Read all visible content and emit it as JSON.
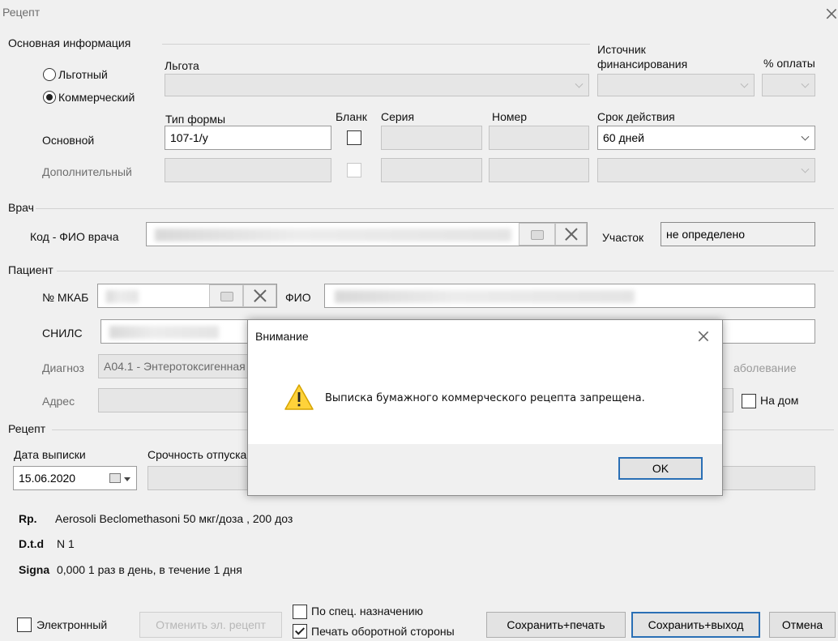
{
  "window": {
    "title": "Рецепт"
  },
  "main_info": {
    "section": "Основная информация",
    "radio_lgot": "Льготный",
    "radio_commercial": "Коммерческий",
    "lgota_label": "Льгота",
    "source_label": "Источник финансирования",
    "pay_label": "% оплаты",
    "form_type_label": "Тип формы",
    "blank_label": "Бланк",
    "series_label": "Серия",
    "number_label": "Номер",
    "validity_label": "Срок действия",
    "main_row_label": "Основной",
    "extra_row_label": "Дополнительный",
    "form_type_value": "107-1/у",
    "validity_value": "60 дней"
  },
  "doctor": {
    "section": "Врач",
    "code_label": "Код - ФИО врача",
    "district_label": "Участок",
    "district_value": "не определено"
  },
  "patient": {
    "section": "Пациент",
    "mkab_label": "№ МКАБ",
    "fio_label": "ФИО",
    "snils_label": "СНИЛС",
    "diagnosis_label": "Диагноз",
    "diagnosis_value": "А04.1 - Энтеротоксигенная",
    "disease_suffix": "аболевание",
    "address_label": "Адрес",
    "home_label": "На дом"
  },
  "recipe": {
    "section": "Рецепт",
    "date_label": "Дата выписки",
    "urgency_label": "Срочность отпуска",
    "date_value": "15.06.2020",
    "rp_label": "Rp.",
    "rp_value": "Aerosoli Beclomethasoni 50 мкг/доза , 200 доз",
    "dtd_label": "D.t.d",
    "dtd_value": "N 1",
    "signa_label": "Signa",
    "signa_value": "0,000 1 раз в день, в течение 1 дня"
  },
  "bottom": {
    "electronic": "Электронный",
    "cancel_erecipe": "Отменить эл. рецепт",
    "special": "По спец. назначению",
    "print_back": "Печать оборотной стороны",
    "save_print": "Сохранить+печать",
    "save_exit": "Сохранить+выход",
    "cancel": "Отмена"
  },
  "dialog": {
    "title": "Внимание",
    "message": "Выписка бумажного коммерческого рецепта запрещена.",
    "ok": "OK",
    "icon": "warning-icon"
  }
}
